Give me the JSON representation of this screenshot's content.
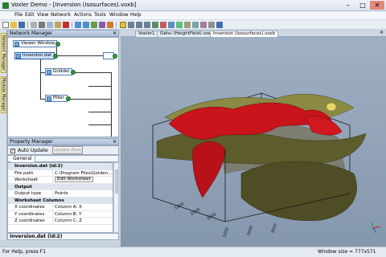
{
  "window": {
    "title": "Voxler Demo - [Inversion (Isosurfaces).voxb]",
    "minimize": "–",
    "maximize": "□",
    "close": "✕"
  },
  "menu": [
    "File",
    "Edit",
    "View",
    "Network",
    "Actions",
    "Tools",
    "Window",
    "Help"
  ],
  "side_tabs": [
    "Network Manager",
    "Module Manager"
  ],
  "network_manager": {
    "title": "Network Manager",
    "close": "✕",
    "nodes": [
      "Viewer Window",
      "Inversion.dat",
      "Gridder",
      "Filter"
    ]
  },
  "property_manager": {
    "title": "Property Manager",
    "close": "✕",
    "auto_update_label": "Auto Update",
    "auto_update_checked": "✓",
    "update_now_label": "Update Now",
    "tab": "General",
    "rows": [
      {
        "type": "header",
        "key": "Inversion.dat (id:2)"
      },
      {
        "type": "prop",
        "key": "File path",
        "value": "C:\\Program Files\\Golden..."
      },
      {
        "type": "button",
        "key": "Worksheet",
        "value": "Edit Worksheet"
      },
      {
        "type": "header",
        "key": "Output"
      },
      {
        "type": "prop",
        "key": "Output type",
        "value": "Points"
      },
      {
        "type": "header",
        "key": "Worksheet Columns"
      },
      {
        "type": "prop",
        "key": "X coordinates",
        "value": "Column A: X"
      },
      {
        "type": "prop",
        "key": "Y coordinates",
        "value": "Column B: Y"
      },
      {
        "type": "prop",
        "key": "Z coordinates",
        "value": "Column C: Z"
      }
    ],
    "footer": "Inversion.dat (id:2)"
  },
  "doc_tabs": [
    "Voxler1",
    "Oahu (HeightField).voxb",
    "Inversion (Isosurfaces).voxb"
  ],
  "doc_tabs_close": "✕",
  "viewport": {
    "axis_labels": [
      "1000",
      "2000",
      "3000",
      "1000",
      "2000",
      "3000"
    ]
  },
  "colors": {
    "red_surface": "#c8141a",
    "olive_surface": "#6b6a2f",
    "gray_surface": "#8a8a80",
    "viewport_bg": "#93a5ba"
  },
  "statusbar": {
    "help": "For Help, press F1",
    "window_size": "Window size = 777x571"
  }
}
